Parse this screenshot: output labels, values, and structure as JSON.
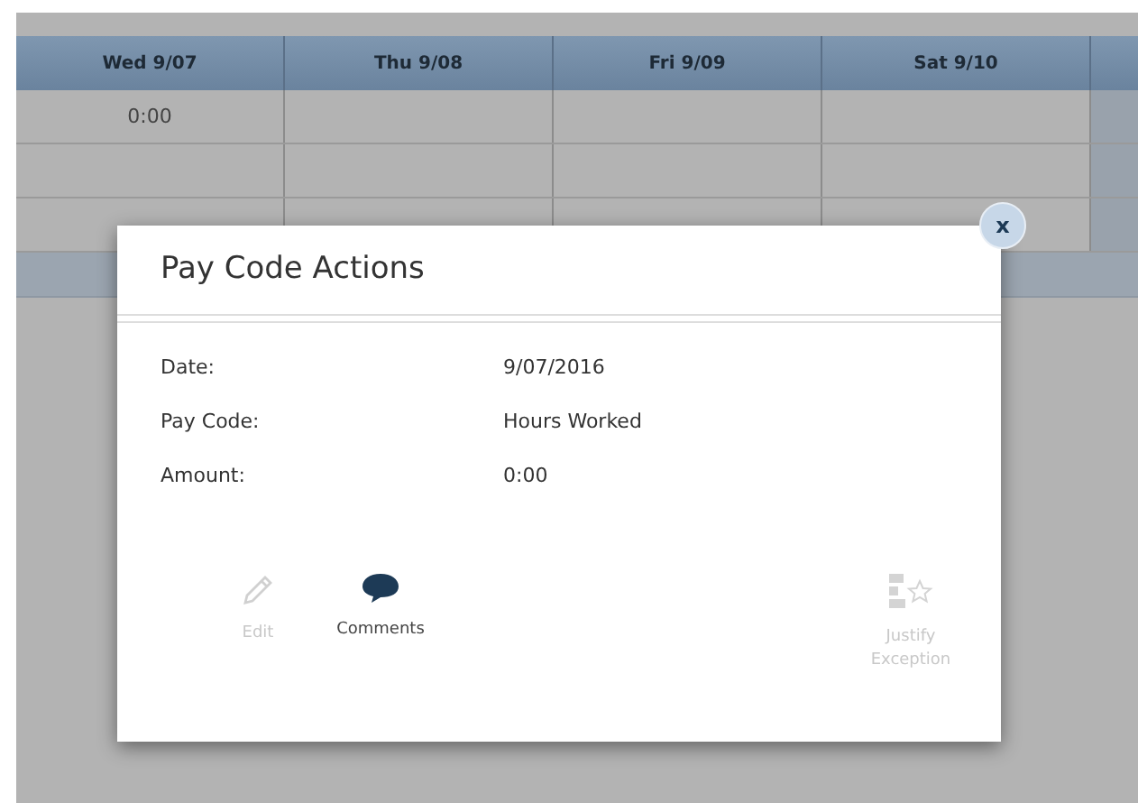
{
  "grid": {
    "columns": [
      "Wed 9/07",
      "Thu 9/08",
      "Fri 9/09",
      "Sat 9/10"
    ],
    "rows": [
      [
        "0:00",
        "",
        "",
        ""
      ],
      [
        "",
        "",
        "",
        ""
      ],
      [
        "",
        "",
        "",
        ""
      ]
    ]
  },
  "dialog": {
    "title": "Pay Code Actions",
    "close": "x",
    "fields": [
      {
        "label": "Date:",
        "value": "9/07/2016"
      },
      {
        "label": "Pay Code:",
        "value": "Hours Worked"
      },
      {
        "label": "Amount:",
        "value": "0:00"
      }
    ],
    "actions": [
      {
        "kind": "edit",
        "label": "Edit",
        "disabled": true
      },
      {
        "kind": "comments",
        "label": "Comments",
        "disabled": false
      },
      {
        "kind": "justify",
        "label": "Justify Exception",
        "disabled": true
      }
    ]
  }
}
